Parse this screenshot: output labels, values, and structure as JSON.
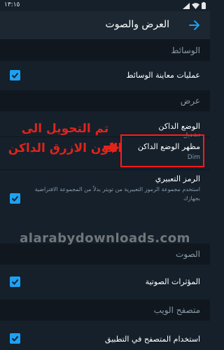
{
  "status_bar": {
    "time": "١٣:١٥"
  },
  "app_bar": {
    "title": "العرض والصوت"
  },
  "sections": {
    "media": "الوسائط",
    "display": "عرض",
    "sound": "الصوت",
    "web": "متصفح الويب"
  },
  "settings": {
    "media_previews": {
      "title": "عمليات معاينة الوسائط",
      "checked": true
    },
    "dark_mode": {
      "title": "الوضع الداكن",
      "value": "تشغيل"
    },
    "dark_mode_appearance": {
      "title": "مظهر الوضع الداكن",
      "value": "Dim"
    },
    "emoji": {
      "title": "الرمز التعبيري",
      "description": "استخدم مجموعة الرموز التعبيرية من تويتر بدلاً من المجموعة الافتراضية بجهازك",
      "checked": true
    },
    "sound_effects": {
      "title": "المؤثرات الصوتية",
      "checked": true
    },
    "in_app_browser": {
      "title": "استخدام المتصفح في التطبيق",
      "checked": true
    }
  },
  "annotation": {
    "line1": "تم التحويل الى",
    "line2": "اللون الازرق الداكن",
    "color": "#e0241b"
  },
  "watermark": "alarabydownloads.com",
  "colors": {
    "background": "#15202b",
    "section_header": "#10171e",
    "accent": "#1da1f2",
    "secondary_text": "#8899a6"
  }
}
